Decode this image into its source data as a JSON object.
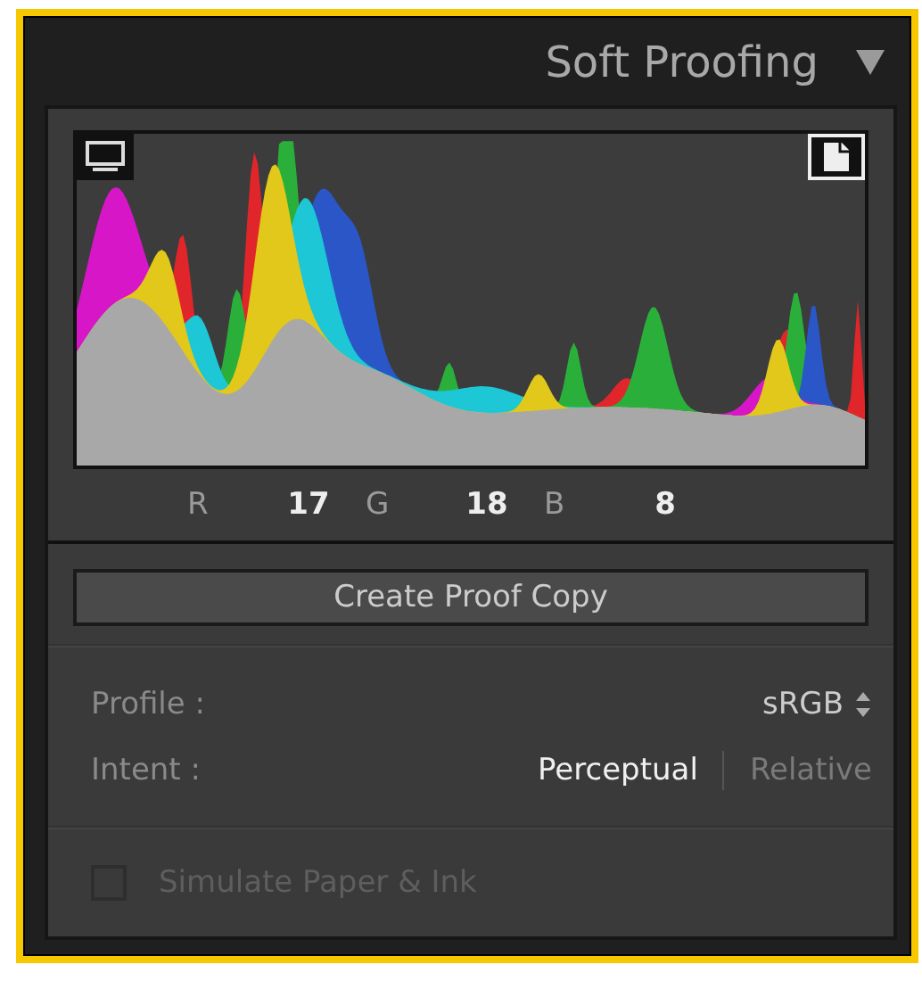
{
  "panel": {
    "title": "Soft Proofing"
  },
  "readouts": [
    {
      "label": "R",
      "value": "17"
    },
    {
      "label": "G",
      "value": "18"
    },
    {
      "label": "B",
      "value": "8"
    }
  ],
  "proof_button": {
    "label": "Create Proof Copy"
  },
  "profile": {
    "label": "Profile :",
    "value": "sRGB"
  },
  "intent": {
    "label": "Intent :",
    "options": [
      {
        "label": "Perceptual",
        "selected": true
      },
      {
        "label": "Relative",
        "selected": false
      }
    ]
  },
  "simulate": {
    "label": "Simulate Paper & Ink",
    "checked": false,
    "disabled": true
  }
}
